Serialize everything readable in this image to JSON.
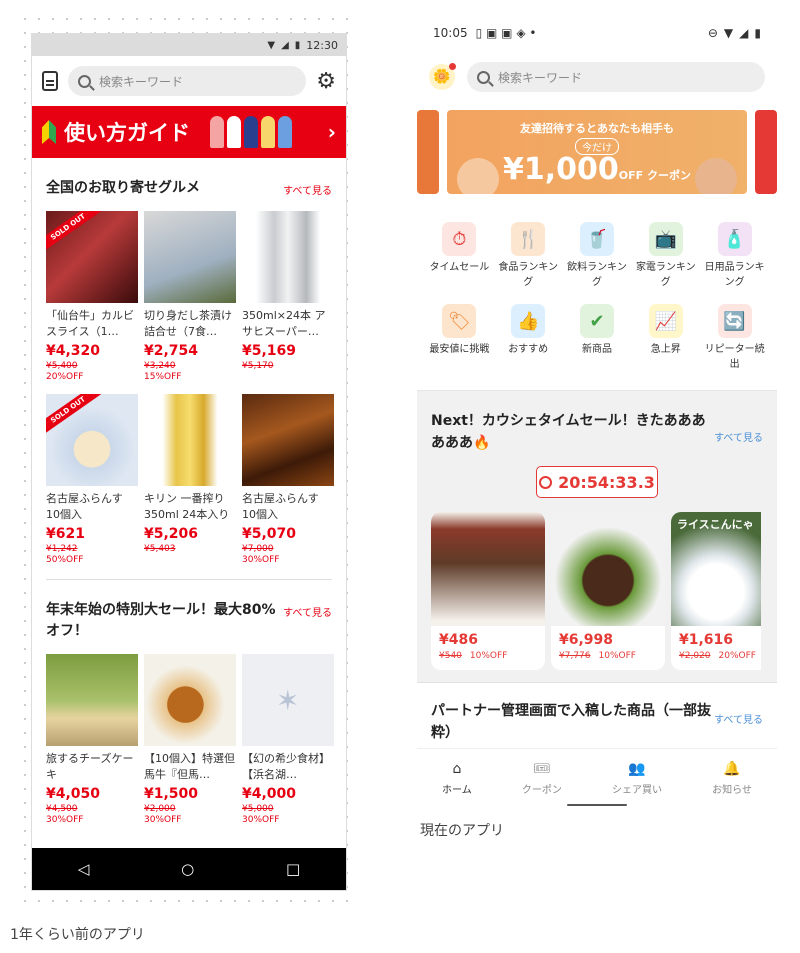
{
  "captions": {
    "old": "1年くらい前のアプリ",
    "new": "現在のアプリ"
  },
  "old_app": {
    "status_time": "12:30",
    "search_placeholder": "検索キーワード",
    "guide_banner": "使い方ガイド",
    "section1": {
      "title": "全国のお取り寄せグルメ",
      "see_all": "すべて見る",
      "products": [
        {
          "name": "「仙台牛」カルビスライス（1…",
          "price": "¥4,320",
          "old": "¥5,400",
          "off": "20%OFF",
          "sold_out": "SOLD OUT",
          "img": "beef"
        },
        {
          "name": "切り身だし茶漬け詰合せ（7食…",
          "price": "¥2,754",
          "old": "¥3,240",
          "off": "15%OFF",
          "img": "tea"
        },
        {
          "name": "350ml×24本 アサヒスーパー…",
          "price": "¥5,169",
          "old": "¥5,170",
          "off": "",
          "img": "asahi"
        },
        {
          "name": "名古屋ふらんす 10個入",
          "price": "¥621",
          "old": "¥1,242",
          "off": "50%OFF",
          "sold_out": "SOLD OUT",
          "img": "cake"
        },
        {
          "name": "キリン 一番搾り 350ml 24本入り",
          "price": "¥5,206",
          "old": "¥5,403",
          "off": "",
          "img": "kirin"
        },
        {
          "name": "名古屋ふらんす 10個入",
          "price": "¥5,070",
          "old": "¥7,000",
          "off": "30%OFF",
          "img": "eel"
        }
      ]
    },
    "section2": {
      "title": "年末年始の特別大セール！最大80%オフ！",
      "see_all": "すべて見る",
      "products": [
        {
          "name": "旅するチーズケーキ",
          "price": "¥4,050",
          "old": "¥4,500",
          "off": "30%OFF",
          "img": "cheese"
        },
        {
          "name": "【10個入】特選但馬牛『但馬…",
          "price": "¥1,500",
          "old": "¥2,000",
          "off": "30%OFF",
          "img": "croquette"
        },
        {
          "name": "【幻の希少食材】【浜名湖…",
          "price": "¥4,000",
          "old": "¥5,000",
          "off": "30%OFF",
          "img": "placeholder"
        }
      ]
    }
  },
  "new_app": {
    "status_time": "10:05",
    "search_placeholder": "検索キーワード",
    "banner": {
      "top": "友達招待するとあなたも相手も",
      "now": "今だけ",
      "amount": "¥1,000",
      "unit": "OFF クーポン"
    },
    "categories": [
      {
        "label": "タイムセール",
        "icon": "⏱",
        "bg": "#fde5e2",
        "fg": "#e53935"
      },
      {
        "label": "食品ランキング",
        "icon": "🍴",
        "bg": "#fde6cf",
        "fg": "#e8783a"
      },
      {
        "label": "飲料ランキング",
        "icon": "🥤",
        "bg": "#dcefff",
        "fg": "#3c9be6"
      },
      {
        "label": "家電ランキング",
        "icon": "📺",
        "bg": "#e1f3dd",
        "fg": "#4caf50"
      },
      {
        "label": "日用品ランキング",
        "icon": "🧴",
        "bg": "#f3e1f5",
        "fg": "#b45cc4"
      },
      {
        "label": "最安値に挑戦",
        "icon": "🏷",
        "bg": "#fde4cc",
        "fg": "#ef8a38"
      },
      {
        "label": "おすすめ",
        "icon": "👍",
        "bg": "#dcefff",
        "fg": "#3c9be6"
      },
      {
        "label": "新商品",
        "icon": "✔",
        "bg": "#e1f3dd",
        "fg": "#43a047"
      },
      {
        "label": "急上昇",
        "icon": "📈",
        "bg": "#fff6c9",
        "fg": "#f0c000"
      },
      {
        "label": "リピーター続出",
        "icon": "🔄",
        "bg": "#fde5e2",
        "fg": "#e53935"
      }
    ],
    "sale": {
      "title": "Next！カウシェタイムセール！きたああああああ🔥",
      "see_all": "すべて見る",
      "timer": "20:54:33.3",
      "cards": [
        {
          "price": "¥486",
          "old": "¥540",
          "off": "10%OFF",
          "img": "mushroom"
        },
        {
          "price": "¥6,998",
          "old": "¥7,776",
          "off": "10%OFF",
          "img": "hamburg"
        },
        {
          "price": "¥1,616",
          "old": "¥2,020",
          "off": "20%OFF",
          "img": "rice",
          "overlay": "ライスこんにゃ"
        }
      ]
    },
    "partner": {
      "title": "パートナー管理画面で入稿した商品（一部抜粋）",
      "see_all": "すべて見る"
    },
    "nav": [
      {
        "label": "ホーム",
        "icon": "⌂",
        "active": true
      },
      {
        "label": "クーポン",
        "icon": "🎟",
        "active": false
      },
      {
        "label": "シェア買い",
        "icon": "👥",
        "active": false
      },
      {
        "label": "お知らせ",
        "icon": "🔔",
        "active": false
      }
    ]
  }
}
